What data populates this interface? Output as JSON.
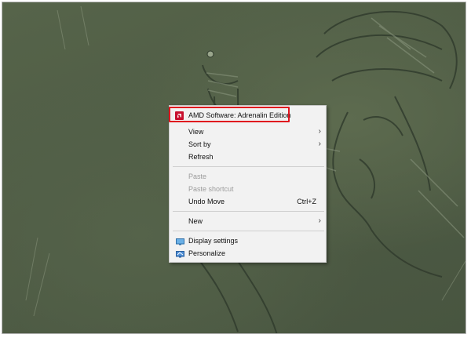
{
  "desktop": {
    "wallpaper": "sketch-illustration"
  },
  "context_menu": {
    "amd_item": {
      "label": "AMD Software: Adrenalin Edition",
      "icon": "amd-logo-icon",
      "highlight_color": "#e0141e"
    },
    "items": [
      {
        "label": "View",
        "submenu": true
      },
      {
        "label": "Sort by",
        "submenu": true
      },
      {
        "label": "Refresh"
      },
      {
        "label": "Paste",
        "disabled": true
      },
      {
        "label": "Paste shortcut",
        "disabled": true
      },
      {
        "label": "Undo Move",
        "shortcut": "Ctrl+Z"
      },
      {
        "label": "New",
        "submenu": true
      },
      {
        "label": "Display settings",
        "icon": "display-settings-icon"
      },
      {
        "label": "Personalize",
        "icon": "personalize-icon"
      }
    ],
    "submenu_arrow": "›"
  }
}
